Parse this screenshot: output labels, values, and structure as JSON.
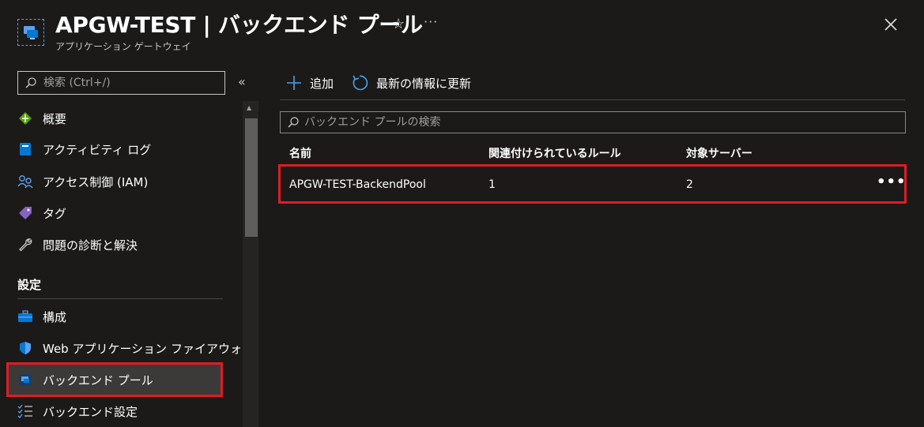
{
  "header": {
    "title": "APGW-TEST | バックエンド プール",
    "subtitle": "アプリケーション ゲートウェイ",
    "star_icon": "star-icon",
    "more_icon": "ellipsis-icon",
    "more_label": "···",
    "close_icon": "close-icon"
  },
  "sidebar": {
    "search_placeholder": "検索 (Ctrl+/)",
    "collapse_label": "«",
    "items": [
      {
        "label": "概要",
        "icon": "overview-icon"
      },
      {
        "label": "アクティビティ ログ",
        "icon": "activity-log-icon"
      },
      {
        "label": "アクセス制御 (IAM)",
        "icon": "iam-icon"
      },
      {
        "label": "タグ",
        "icon": "tag-icon"
      },
      {
        "label": "問題の診断と解決",
        "icon": "wrench-icon"
      }
    ],
    "section_label": "設定",
    "settings_items": [
      {
        "label": "構成",
        "icon": "briefcase-icon"
      },
      {
        "label": "Web アプリケーション ファイアウォール",
        "icon": "shield-icon"
      },
      {
        "label": "バックエンド プール",
        "icon": "backend-pool-icon",
        "active": true
      },
      {
        "label": "バックエンド設定",
        "icon": "checklist-icon"
      }
    ]
  },
  "toolbar": {
    "add_label": "追加",
    "refresh_label": "最新の情報に更新"
  },
  "search": {
    "placeholder": "バックエンド プールの検索"
  },
  "table": {
    "columns": [
      "名前",
      "関連付けられているルール",
      "対象サーバー"
    ],
    "rows": [
      {
        "name": "APGW-TEST-BackendPool",
        "rules": "1",
        "targets": "2",
        "more": "•••"
      }
    ]
  },
  "colors": {
    "background": "#1b1a19",
    "accent": "#0078d4",
    "highlight": "#e01b24"
  }
}
